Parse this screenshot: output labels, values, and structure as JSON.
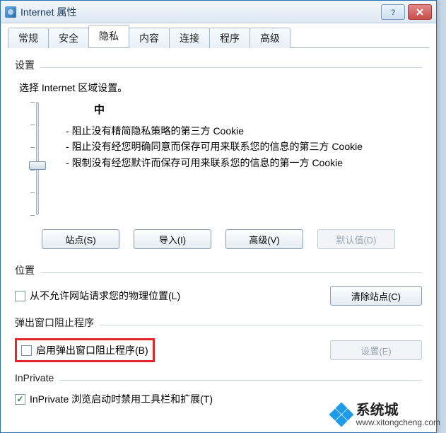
{
  "window": {
    "title": "Internet 属性"
  },
  "tabs": {
    "items": [
      {
        "label": "常规"
      },
      {
        "label": "安全"
      },
      {
        "label": "隐私"
      },
      {
        "label": "内容"
      },
      {
        "label": "连接"
      },
      {
        "label": "程序"
      },
      {
        "label": "高级"
      }
    ],
    "active_index": 2
  },
  "settings_section": {
    "title": "设置",
    "select_label": "选择 Internet 区域设置。",
    "level_label": "中",
    "bullets": [
      "阻止没有精简隐私策略的第三方 Cookie",
      "阻止没有经您明确同意而保存可用来联系您的信息的第三方 Cookie",
      "限制没有经您默许而保存可用来联系您的信息的第一方 Cookie"
    ],
    "buttons": {
      "sites": "站点(S)",
      "import": "导入(I)",
      "advanced": "高级(V)",
      "default": "默认值(D)"
    }
  },
  "location_section": {
    "title": "位置",
    "checkbox_label": "从不允许网站请求您的物理位置(L)",
    "checkbox_checked": false,
    "clear_button": "清除站点(C)"
  },
  "popup_section": {
    "title": "弹出窗口阻止程序",
    "checkbox_label": "启用弹出窗口阻止程序(B)",
    "checkbox_checked": false,
    "settings_button": "设置(E)"
  },
  "inprivate_section": {
    "title": "InPrivate",
    "checkbox_label": "InPrivate 浏览启动时禁用工具栏和扩展(T)",
    "checkbox_checked": true
  },
  "watermark": {
    "brand": "系统城",
    "url": "www.xitongcheng.com"
  }
}
